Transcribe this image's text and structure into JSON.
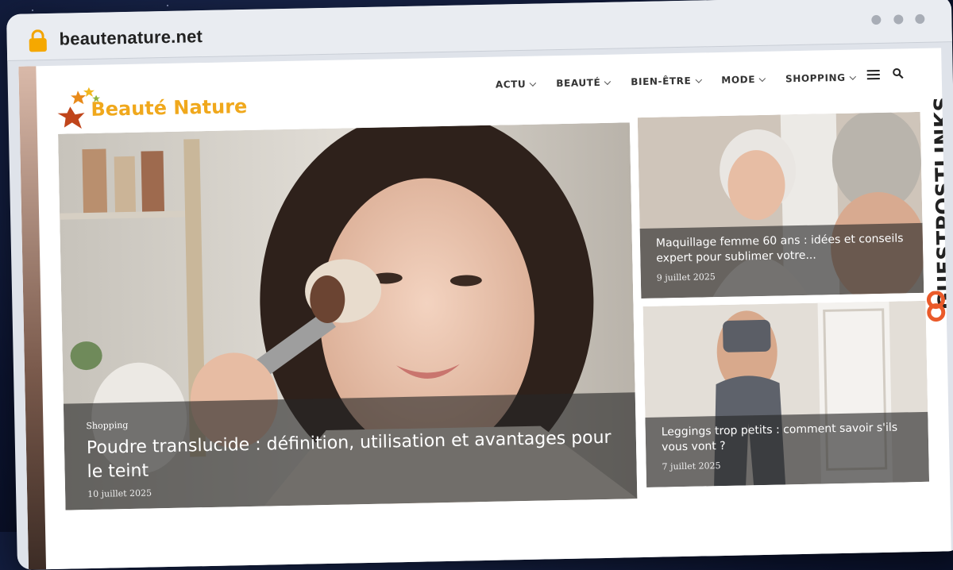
{
  "browser": {
    "url": "beautenature.net",
    "side_brand": "GUESTPOSTLINKS"
  },
  "site": {
    "logo_text": "Beauté Nature",
    "nav": [
      {
        "label": "ACTU"
      },
      {
        "label": "BEAUTÉ"
      },
      {
        "label": "BIEN-ÊTRE"
      },
      {
        "label": "MODE"
      },
      {
        "label": "SHOPPING"
      }
    ],
    "menu_icon": "hamburger-icon",
    "search_icon": "search-icon"
  },
  "articles": {
    "main": {
      "category": "Shopping",
      "title": "Poudre translucide : définition, utilisation et avantages pour le teint",
      "date": "10 juillet 2025"
    },
    "side": [
      {
        "title": "Maquillage femme 60 ans : idées et conseils expert pour sublimer votre...",
        "date": "9 juillet 2025"
      },
      {
        "title": "Leggings trop petits : comment savoir s'ils vous vont ?",
        "date": "7 juillet 2025"
      }
    ]
  },
  "colors": {
    "logo": "#f0a81c",
    "lock": "#f5a800",
    "overlay": "#262626"
  }
}
